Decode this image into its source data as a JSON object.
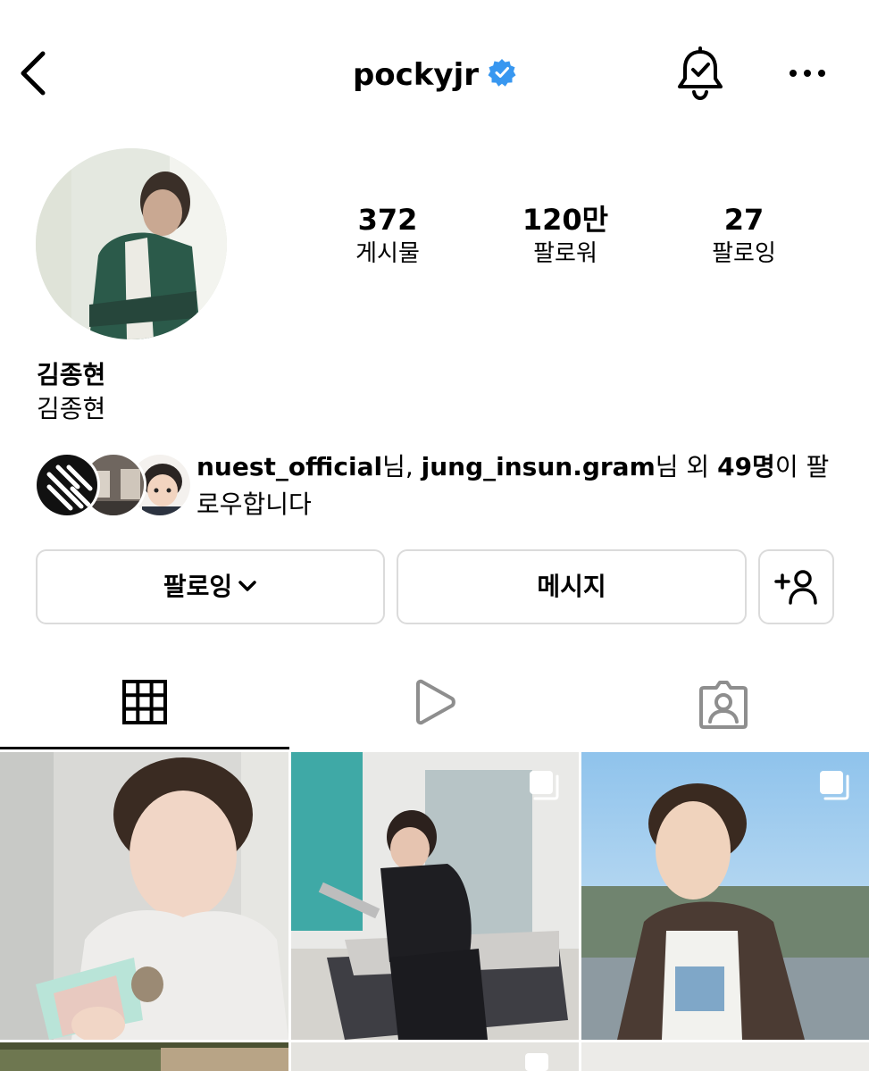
{
  "header": {
    "username": "pockyjr",
    "icons": {
      "back": "chevron-left-icon",
      "verified": "verified-badge-icon",
      "notifications": "bell-check-icon",
      "more": "more-dots-icon"
    }
  },
  "stats": [
    {
      "value": "372",
      "label": "게시물"
    },
    {
      "value": "120만",
      "label": "팔로워"
    },
    {
      "value": "27",
      "label": "팔로잉"
    }
  ],
  "profile": {
    "display_name": "김종현",
    "category_name": "김종현"
  },
  "followed_by": {
    "user1": "nuest_official",
    "suffix1": "님, ",
    "user2": "jung_insun.gram",
    "suffix2": "님 외 ",
    "count": "49명",
    "suffix3": "이 팔로우합니다"
  },
  "buttons": {
    "following": "팔로잉",
    "message": "메시지",
    "add_friend_icon": "person-add-icon"
  },
  "tabs": [
    {
      "name": "posts",
      "icon": "grid-icon",
      "active": true
    },
    {
      "name": "reels",
      "icon": "play-icon",
      "active": false
    },
    {
      "name": "tagged",
      "icon": "tagged-person-icon",
      "active": false
    }
  ],
  "colors": {
    "verified": "#3897f0",
    "border": "#dbdbdb",
    "text": "#000000"
  }
}
